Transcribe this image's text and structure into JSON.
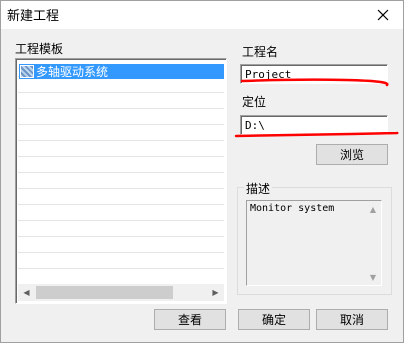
{
  "window": {
    "title": "新建工程",
    "close_glyph": "✕"
  },
  "templates": {
    "label": "工程模板",
    "items": [
      "多轴驱动系统"
    ],
    "scroll_left": "◀",
    "scroll_right": "▶"
  },
  "project_name": {
    "label": "工程名",
    "value": "Project"
  },
  "location": {
    "label": "定位",
    "value": "D:\\"
  },
  "browse_label": "浏览",
  "description": {
    "label": "描述",
    "text": "Monitor system",
    "scroll_up": "▲",
    "scroll_down": "▼"
  },
  "buttons": {
    "view": "查看",
    "ok": "确定",
    "cancel": "取消"
  },
  "colors": {
    "selection": "#3399ff",
    "annotation": "#ff0000"
  }
}
